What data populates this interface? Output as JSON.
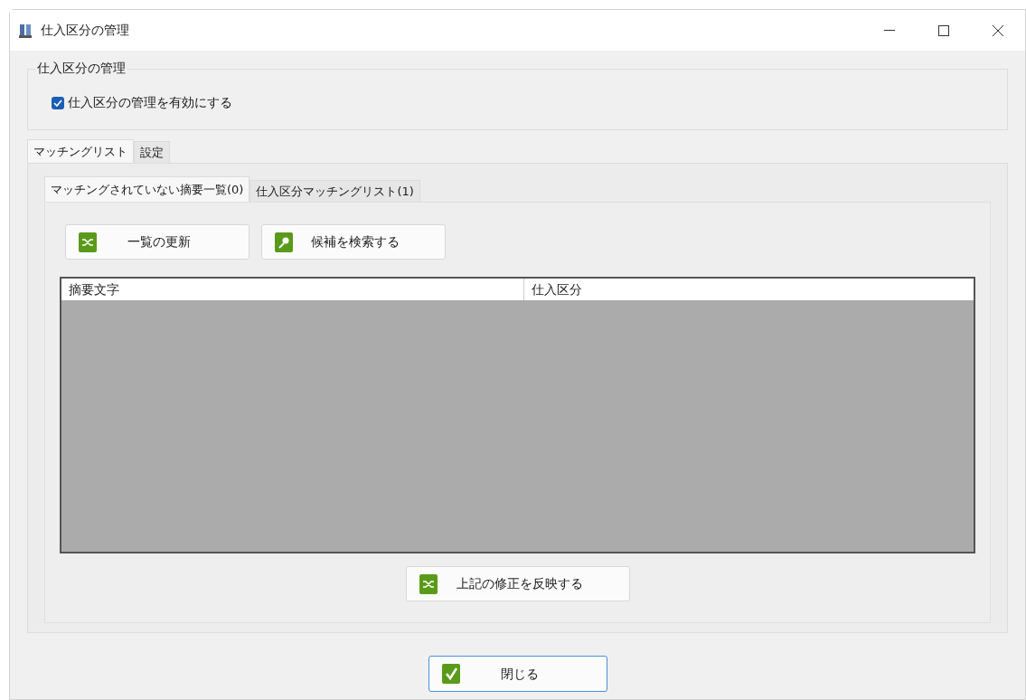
{
  "window": {
    "title": "仕入区分の管理"
  },
  "group": {
    "title": "仕入区分の管理",
    "checkbox": {
      "label": "仕入区分の管理を有効にする",
      "checked": true
    }
  },
  "tabs": [
    {
      "label": "マッチングリスト",
      "selected": true
    },
    {
      "label": "設定",
      "selected": false
    }
  ],
  "subtabs": [
    {
      "label": "マッチングされていない摘要一覧(0)",
      "selected": true
    },
    {
      "label": "仕入区分マッチングリスト(1)",
      "selected": false
    }
  ],
  "toolbar_buttons": [
    {
      "label": "一覧の更新",
      "kind": "shuffle"
    },
    {
      "label": "候補を検索する",
      "kind": "search"
    }
  ],
  "table": {
    "columns": [
      "摘要文字",
      "仕入区分"
    ]
  },
  "apply_button": {
    "label": "上記の修正を反映する",
    "kind": "shuffle"
  },
  "close_button": {
    "label": "閉じる",
    "kind": "check"
  }
}
